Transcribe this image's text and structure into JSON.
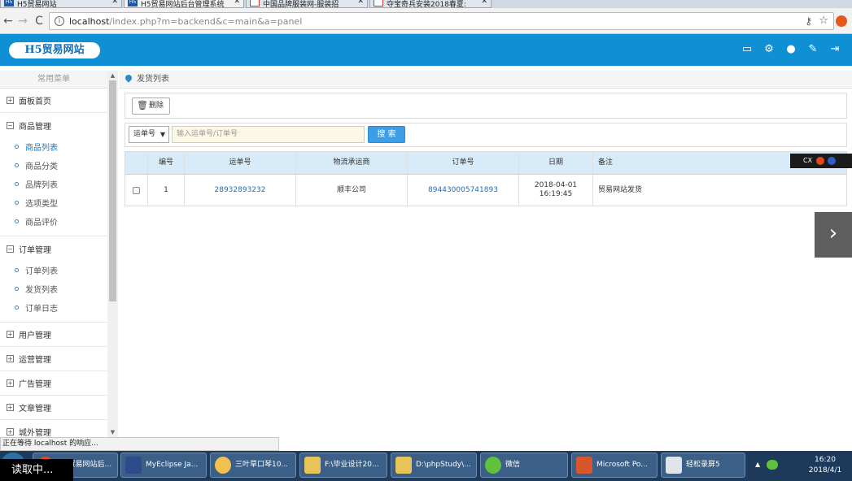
{
  "browser": {
    "tabs": [
      {
        "label": "H5贸易网站",
        "fav": "H5"
      },
      {
        "label": "H5贸易网站后台管理系统",
        "fav": "H5"
      },
      {
        "label": "中国品牌服装网-服装招",
        "fav": "red"
      },
      {
        "label": "夺宝奇兵安装2018春夏:",
        "fav": "red"
      }
    ],
    "url_host": "localhost",
    "url_path": "/index.php?m=backend&c=main&a=panel",
    "status_text": "正在等待 localhost 的响应..."
  },
  "header": {
    "logo_text": "H5贸易网站",
    "icons": [
      "monitor-icon",
      "gear-icon",
      "user-icon",
      "brush-icon",
      "logout-icon"
    ]
  },
  "sidebar": {
    "title": "常用菜单",
    "panel_home": "面板首页",
    "goods": {
      "label": "商品管理",
      "items": [
        "商品列表",
        "商品分类",
        "品牌列表",
        "选项类型",
        "商品评价"
      ]
    },
    "orders": {
      "label": "订单管理",
      "items": [
        "订单列表",
        "发货列表",
        "订单日志"
      ]
    },
    "groups": [
      "用户管理",
      "运营管理",
      "广告管理",
      "文章管理",
      "城外管理"
    ]
  },
  "main": {
    "breadcrumb": "发货列表",
    "delete_label": "删除",
    "search": {
      "select_value": "运单号",
      "placeholder": "输入运单号/订单号",
      "button_label": "搜 索"
    },
    "table": {
      "headers": [
        "编号",
        "运单号",
        "物流承运商",
        "订单号",
        "日期",
        "备注"
      ],
      "rows": [
        {
          "id": "1",
          "waybill": "28932893232",
          "carrier": "顺丰公司",
          "order_no": "894430005741893",
          "date": "2018-04-01",
          "time": "16:19:45",
          "note": "贸易网站发货"
        }
      ]
    }
  },
  "overlay": {
    "mini_bar_label": "CX"
  },
  "taskbar": {
    "buttons": [
      "H5贸易网站后...",
      "MyEclipse Ja...",
      "三叶草口琴10...",
      "F:\\毕业设计20...",
      "D:\\phpStudy\\...",
      "微信",
      "Microsoft Po...",
      "轻松录屏5"
    ],
    "time": "16:20",
    "date": "2018/4/1",
    "reading_label": "读取中..."
  }
}
